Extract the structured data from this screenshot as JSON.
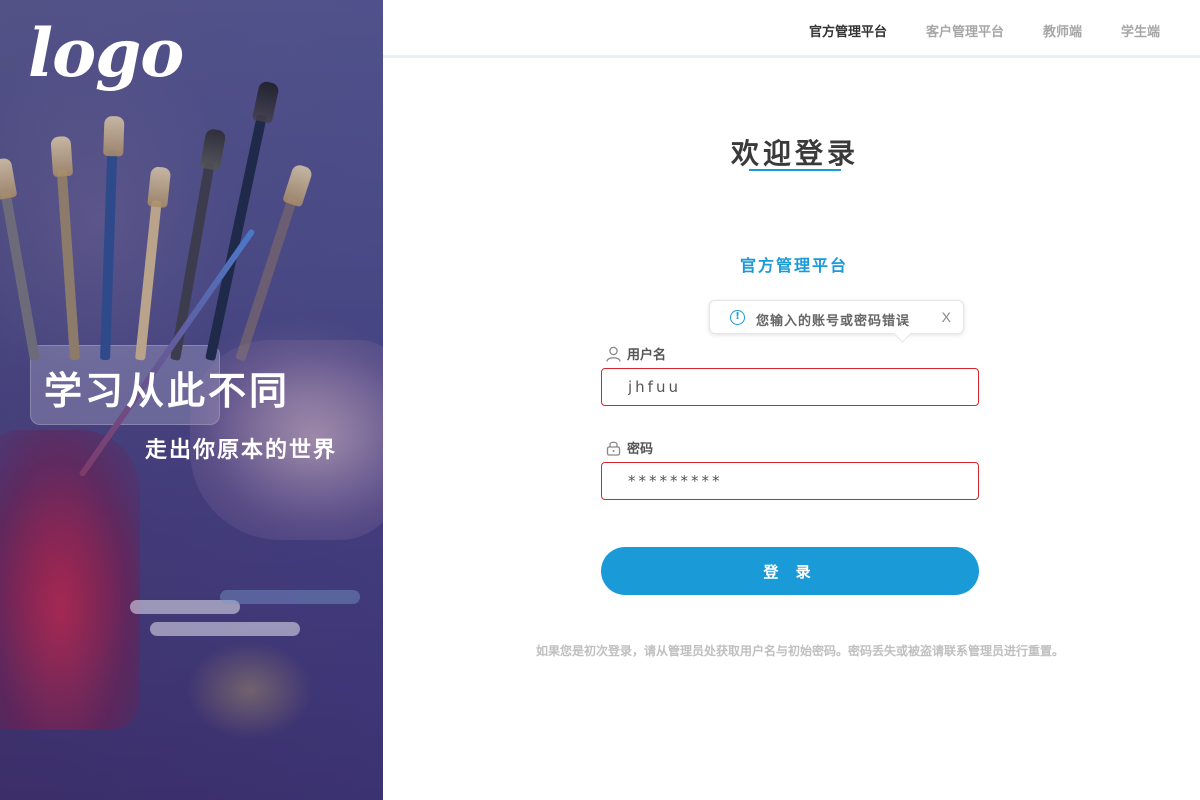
{
  "hero": {
    "logo": "logo",
    "slogan": "学习从此不同",
    "subslogan": "走出你原本的世界"
  },
  "nav": {
    "items": [
      {
        "label": "官方管理平台",
        "active": true
      },
      {
        "label": "客户管理平台",
        "active": false
      },
      {
        "label": "教师端",
        "active": false
      },
      {
        "label": "学生端",
        "active": false
      }
    ]
  },
  "login": {
    "title": "欢迎登录",
    "platform": "官方管理平台",
    "error_tooltip": {
      "icon": "info-circle-icon",
      "message": "您输入的账号或密码错误",
      "close_label": "X"
    },
    "username": {
      "label": "用户名",
      "icon": "user-icon",
      "value": "jhfuu"
    },
    "password": {
      "label": "密码",
      "icon": "lock-icon",
      "value": "*********"
    },
    "submit_label": "登 录",
    "footnote": "如果您是初次登录，请从管理员处获取用户名与初始密码。密码丢失或被盗请联系管理员进行重置。"
  },
  "colors": {
    "accent": "#1a9bd8",
    "error_border": "#d6262b",
    "nav_active": "#333333",
    "nav_inactive": "#a7a7a7"
  }
}
